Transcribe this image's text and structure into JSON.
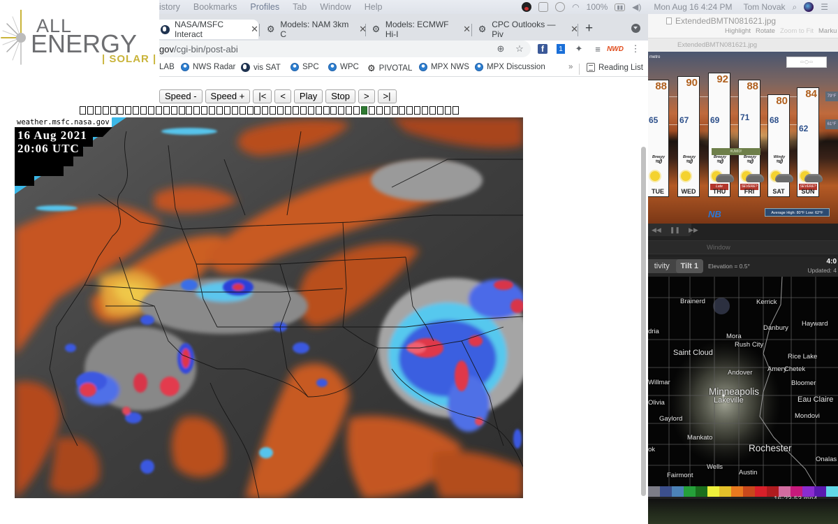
{
  "menubar": {
    "menus": [
      "istory",
      "Bookmarks",
      "Profiles",
      "Tab",
      "Window",
      "Help"
    ],
    "battery": "100%",
    "datetime": "Mon Aug 16  4:24 PM",
    "user": "Tom Novak"
  },
  "logo": {
    "line1": "ALL",
    "line2": "ENERGY",
    "line3": "| SOLAR |"
  },
  "browser": {
    "tabs": [
      {
        "title": "NASA/MSFC Interact",
        "icon": "globe-icon",
        "active": true
      },
      {
        "title": "Models: NAM 3km C",
        "icon": "gear-icon",
        "active": false
      },
      {
        "title": "Models: ECMWF Hi-I",
        "icon": "gear-icon",
        "active": false
      },
      {
        "title": "CPC Outlooks — Piv",
        "icon": "gear-icon",
        "active": false
      }
    ],
    "close_glyph": "✕",
    "new_tab_glyph": "+",
    "url_host": "gov",
    "url_path": "/cgi-bin/post-abi",
    "bookmarks": [
      {
        "label": "LAB",
        "icon": "none"
      },
      {
        "label": "NWS Radar",
        "icon": "noaa-icon"
      },
      {
        "label": "vis SAT",
        "icon": "globe-icon"
      },
      {
        "label": "SPC",
        "icon": "noaa-icon"
      },
      {
        "label": "WPC",
        "icon": "noaa-icon"
      },
      {
        "label": "PIVOTAL",
        "icon": "gear-icon"
      },
      {
        "label": "MPX NWS",
        "icon": "noaa-icon"
      },
      {
        "label": "MPX Discussion",
        "icon": "noaa-icon"
      }
    ],
    "more_bookmarks": "»",
    "reading_list": "Reading List"
  },
  "viewer": {
    "buttons": [
      "Speed -",
      "Speed +",
      "|<",
      "<",
      "Play",
      "Stop",
      ">",
      ">|"
    ],
    "frame_count": 50,
    "current_frame": 37,
    "source_label": "weather.msfc.nasa.gov",
    "date_line": "16 Aug 2021",
    "time_line": "20:06 UTC"
  },
  "preview": {
    "filename": "ExtendedBMTN081621.jpg",
    "tools": [
      "Highlight",
      "Rotate",
      "Zoom to Fit",
      "Marku"
    ],
    "tab_label": "ExtendedBMTN081621.jpg",
    "metro_label": "metro",
    "humid_label": "#UMID!",
    "average": "Average High: 80°F Low: 62°F",
    "ref_high": "79°F",
    "ref_low": "61°F",
    "days": [
      {
        "day": "TUE",
        "hi": 88,
        "lo": 65,
        "wind": "Breezy",
        "sky": "sunny",
        "tag": ""
      },
      {
        "day": "WED",
        "hi": 90,
        "lo": 67,
        "wind": "Breezy",
        "sky": "sunny",
        "tag": ""
      },
      {
        "day": "THU",
        "hi": 92,
        "lo": 69,
        "wind": "Breezy",
        "sky": "storms",
        "tag": "Late"
      },
      {
        "day": "FRI",
        "hi": 88,
        "lo": 71,
        "wind": "Breezy",
        "sky": "storms",
        "tag": "SEVERE?"
      },
      {
        "day": "SAT",
        "hi": 80,
        "lo": 68,
        "wind": "Windy",
        "sky": "storms",
        "tag": ""
      },
      {
        "day": "SUN",
        "hi": 84,
        "lo": 62,
        "wind": "",
        "sky": "storms",
        "tag": "SEVERE?"
      }
    ]
  },
  "radar": {
    "window_label": "Window",
    "product_left": "tivity",
    "product_tilt": "Tilt 1",
    "elevation": "Elevation = 0.5°",
    "time": "4:0",
    "updated": "Updated: 4",
    "cities": [
      {
        "name": "Brainerd",
        "size": "s"
      },
      {
        "name": "Kerrick",
        "size": "s"
      },
      {
        "name": "Danbury",
        "size": "s"
      },
      {
        "name": "Hayward",
        "size": "s"
      },
      {
        "name": "dria",
        "size": "s"
      },
      {
        "name": "Mora",
        "size": "s"
      },
      {
        "name": "Rush City",
        "size": "s"
      },
      {
        "name": "Saint Cloud",
        "size": "m"
      },
      {
        "name": "Rice Lake",
        "size": "s"
      },
      {
        "name": "Andover",
        "size": "s"
      },
      {
        "name": "Amery",
        "size": "s"
      },
      {
        "name": "Chetek",
        "size": "s"
      },
      {
        "name": "Willmar",
        "size": "s"
      },
      {
        "name": "Bloomer",
        "size": "s"
      },
      {
        "name": "Minneapolis",
        "size": "l"
      },
      {
        "name": "Olivia",
        "size": "s"
      },
      {
        "name": "Eau Claire",
        "size": "m"
      },
      {
        "name": "Lakeville",
        "size": "m"
      },
      {
        "name": "Gaylord",
        "size": "s"
      },
      {
        "name": "Mondovi",
        "size": "s"
      },
      {
        "name": "Mankato",
        "size": "s"
      },
      {
        "name": "Rochester",
        "size": "l"
      },
      {
        "name": "ok",
        "size": "s"
      },
      {
        "name": "Onalas",
        "size": "s"
      },
      {
        "name": "Wells",
        "size": "s"
      },
      {
        "name": "Fairmont",
        "size": "s"
      },
      {
        "name": "Austin",
        "size": "s"
      }
    ],
    "color_scale": [
      "#7d7d88",
      "#3c4f8c",
      "#4c82b8",
      "#25a03a",
      "#1a6e1d",
      "#eef03c",
      "#e3c02a",
      "#e8791f",
      "#c8481c",
      "#d8202a",
      "#b01b1f",
      "#d36ca0",
      "#c71a7c",
      "#8a2cd0",
      "#5a1ab0",
      "#62d8e8"
    ],
    "file_label": "16-23-53.mp4"
  }
}
